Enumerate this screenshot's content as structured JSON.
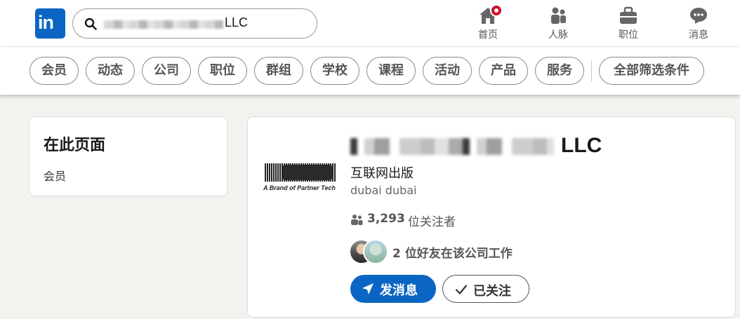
{
  "nav": {
    "search_suffix": "LLC",
    "items": [
      {
        "label": "首页",
        "icon": "home-icon"
      },
      {
        "label": "人脉",
        "icon": "network-icon"
      },
      {
        "label": "职位",
        "icon": "jobs-icon"
      },
      {
        "label": "消息",
        "icon": "messaging-icon"
      }
    ]
  },
  "filters": {
    "pills": [
      "会员",
      "动态",
      "公司",
      "职位",
      "群组",
      "学校",
      "课程",
      "活动",
      "产品",
      "服务"
    ],
    "all_filters": "全部筛选条件"
  },
  "sidebar": {
    "title": "在此页面",
    "item": "会员"
  },
  "result": {
    "name_suffix": "LLC",
    "logo_text": "A Brand of Partner Tech",
    "industry": "互联网出版",
    "location": "dubai dubai",
    "followers_count": "3,293",
    "followers_label": "位关注者",
    "friends_text": "2 位好友在该公司工作",
    "message_button": "发消息",
    "following_button": "已关注"
  },
  "colors": {
    "brand": "#0a66c2",
    "notification": "#cb112d",
    "background": "#f4f2ee"
  }
}
